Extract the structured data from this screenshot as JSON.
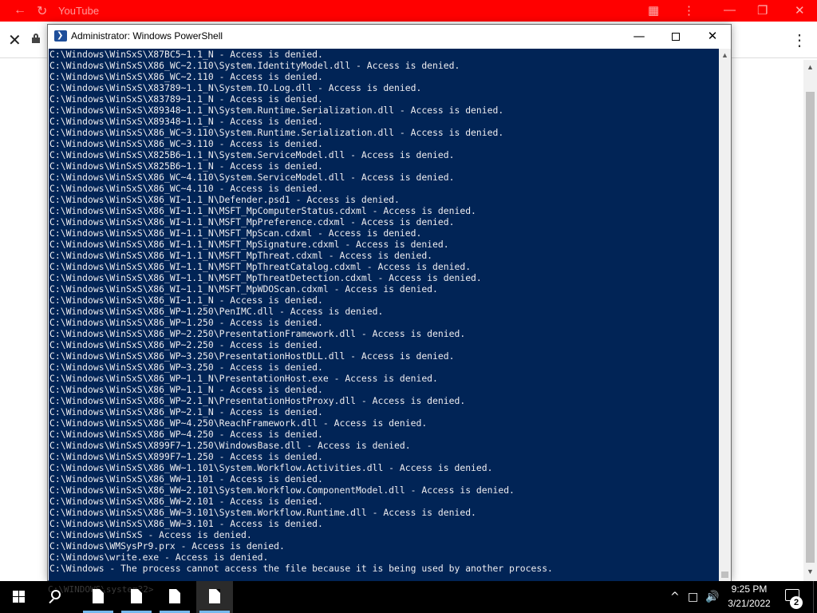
{
  "browser": {
    "title": "YouTube",
    "back_icon": "arrow-left-icon",
    "refresh_icon": "refresh-icon",
    "extensions_icon": "puzzle-icon",
    "menu_icon": "kebab-menu-icon"
  },
  "powershell": {
    "title": "Administrator: Windows PowerShell",
    "lines": [
      "C:\\Windows\\WinSxS\\X87BC5~1.1_N - Access is denied.",
      "C:\\Windows\\WinSxS\\X86_WC~2.110\\System.IdentityModel.dll - Access is denied.",
      "C:\\Windows\\WinSxS\\X86_WC~2.110 - Access is denied.",
      "C:\\Windows\\WinSxS\\X83789~1.1_N\\System.IO.Log.dll - Access is denied.",
      "C:\\Windows\\WinSxS\\X83789~1.1_N - Access is denied.",
      "C:\\Windows\\WinSxS\\X89348~1.1_N\\System.Runtime.Serialization.dll - Access is denied.",
      "C:\\Windows\\WinSxS\\X89348~1.1_N - Access is denied.",
      "C:\\Windows\\WinSxS\\X86_WC~3.110\\System.Runtime.Serialization.dll - Access is denied.",
      "C:\\Windows\\WinSxS\\X86_WC~3.110 - Access is denied.",
      "C:\\Windows\\WinSxS\\X825B6~1.1_N\\System.ServiceModel.dll - Access is denied.",
      "C:\\Windows\\WinSxS\\X825B6~1.1_N - Access is denied.",
      "C:\\Windows\\WinSxS\\X86_WC~4.110\\System.ServiceModel.dll - Access is denied.",
      "C:\\Windows\\WinSxS\\X86_WC~4.110 - Access is denied.",
      "C:\\Windows\\WinSxS\\X86_WI~1.1_N\\Defender.psd1 - Access is denied.",
      "C:\\Windows\\WinSxS\\X86_WI~1.1_N\\MSFT_MpComputerStatus.cdxml - Access is denied.",
      "C:\\Windows\\WinSxS\\X86_WI~1.1_N\\MSFT_MpPreference.cdxml - Access is denied.",
      "C:\\Windows\\WinSxS\\X86_WI~1.1_N\\MSFT_MpScan.cdxml - Access is denied.",
      "C:\\Windows\\WinSxS\\X86_WI~1.1_N\\MSFT_MpSignature.cdxml - Access is denied.",
      "C:\\Windows\\WinSxS\\X86_WI~1.1_N\\MSFT_MpThreat.cdxml - Access is denied.",
      "C:\\Windows\\WinSxS\\X86_WI~1.1_N\\MSFT_MpThreatCatalog.cdxml - Access is denied.",
      "C:\\Windows\\WinSxS\\X86_WI~1.1_N\\MSFT_MpThreatDetection.cdxml - Access is denied.",
      "C:\\Windows\\WinSxS\\X86_WI~1.1_N\\MSFT_MpWDOScan.cdxml - Access is denied.",
      "C:\\Windows\\WinSxS\\X86_WI~1.1_N - Access is denied.",
      "C:\\Windows\\WinSxS\\X86_WP~1.250\\PenIMC.dll - Access is denied.",
      "C:\\Windows\\WinSxS\\X86_WP~1.250 - Access is denied.",
      "C:\\Windows\\WinSxS\\X86_WP~2.250\\PresentationFramework.dll - Access is denied.",
      "C:\\Windows\\WinSxS\\X86_WP~2.250 - Access is denied.",
      "C:\\Windows\\WinSxS\\X86_WP~3.250\\PresentationHostDLL.dll - Access is denied.",
      "C:\\Windows\\WinSxS\\X86_WP~3.250 - Access is denied.",
      "C:\\Windows\\WinSxS\\X86_WP~1.1_N\\PresentationHost.exe - Access is denied.",
      "C:\\Windows\\WinSxS\\X86_WP~1.1_N - Access is denied.",
      "C:\\Windows\\WinSxS\\X86_WP~2.1_N\\PresentationHostProxy.dll - Access is denied.",
      "C:\\Windows\\WinSxS\\X86_WP~2.1_N - Access is denied.",
      "C:\\Windows\\WinSxS\\X86_WP~4.250\\ReachFramework.dll - Access is denied.",
      "C:\\Windows\\WinSxS\\X86_WP~4.250 - Access is denied.",
      "C:\\Windows\\WinSxS\\X899F7~1.250\\WindowsBase.dll - Access is denied.",
      "C:\\Windows\\WinSxS\\X899F7~1.250 - Access is denied.",
      "C:\\Windows\\WinSxS\\X86_WW~1.101\\System.Workflow.Activities.dll - Access is denied.",
      "C:\\Windows\\WinSxS\\X86_WW~1.101 - Access is denied.",
      "C:\\Windows\\WinSxS\\X86_WW~2.101\\System.Workflow.ComponentModel.dll - Access is denied.",
      "C:\\Windows\\WinSxS\\X86_WW~2.101 - Access is denied.",
      "C:\\Windows\\WinSxS\\X86_WW~3.101\\System.Workflow.Runtime.dll - Access is denied.",
      "C:\\Windows\\WinSxS\\X86_WW~3.101 - Access is denied.",
      "C:\\Windows\\WinSxS - Access is denied.",
      "C:\\Windows\\WMSysPr9.prx - Access is denied.",
      "C:\\Windows\\write.exe - Access is denied.",
      "C:\\Windows - The process cannot access the file because it is being used by another process."
    ],
    "ghost_prompt": "C:\\WINDOWS\\system32>"
  },
  "taskbar": {
    "start_icon": "windows-start-icon",
    "search_icon": "search-icon",
    "apps": [
      {
        "name": "taskbar-app-1",
        "icon": "document-icon"
      },
      {
        "name": "taskbar-app-2",
        "icon": "document-icon"
      },
      {
        "name": "taskbar-app-3",
        "icon": "document-icon"
      },
      {
        "name": "taskbar-app-4",
        "icon": "document-icon"
      }
    ],
    "tray": {
      "chevron": "^",
      "time": "9:25 PM",
      "date": "3/21/2022",
      "notification_count": "2"
    }
  }
}
